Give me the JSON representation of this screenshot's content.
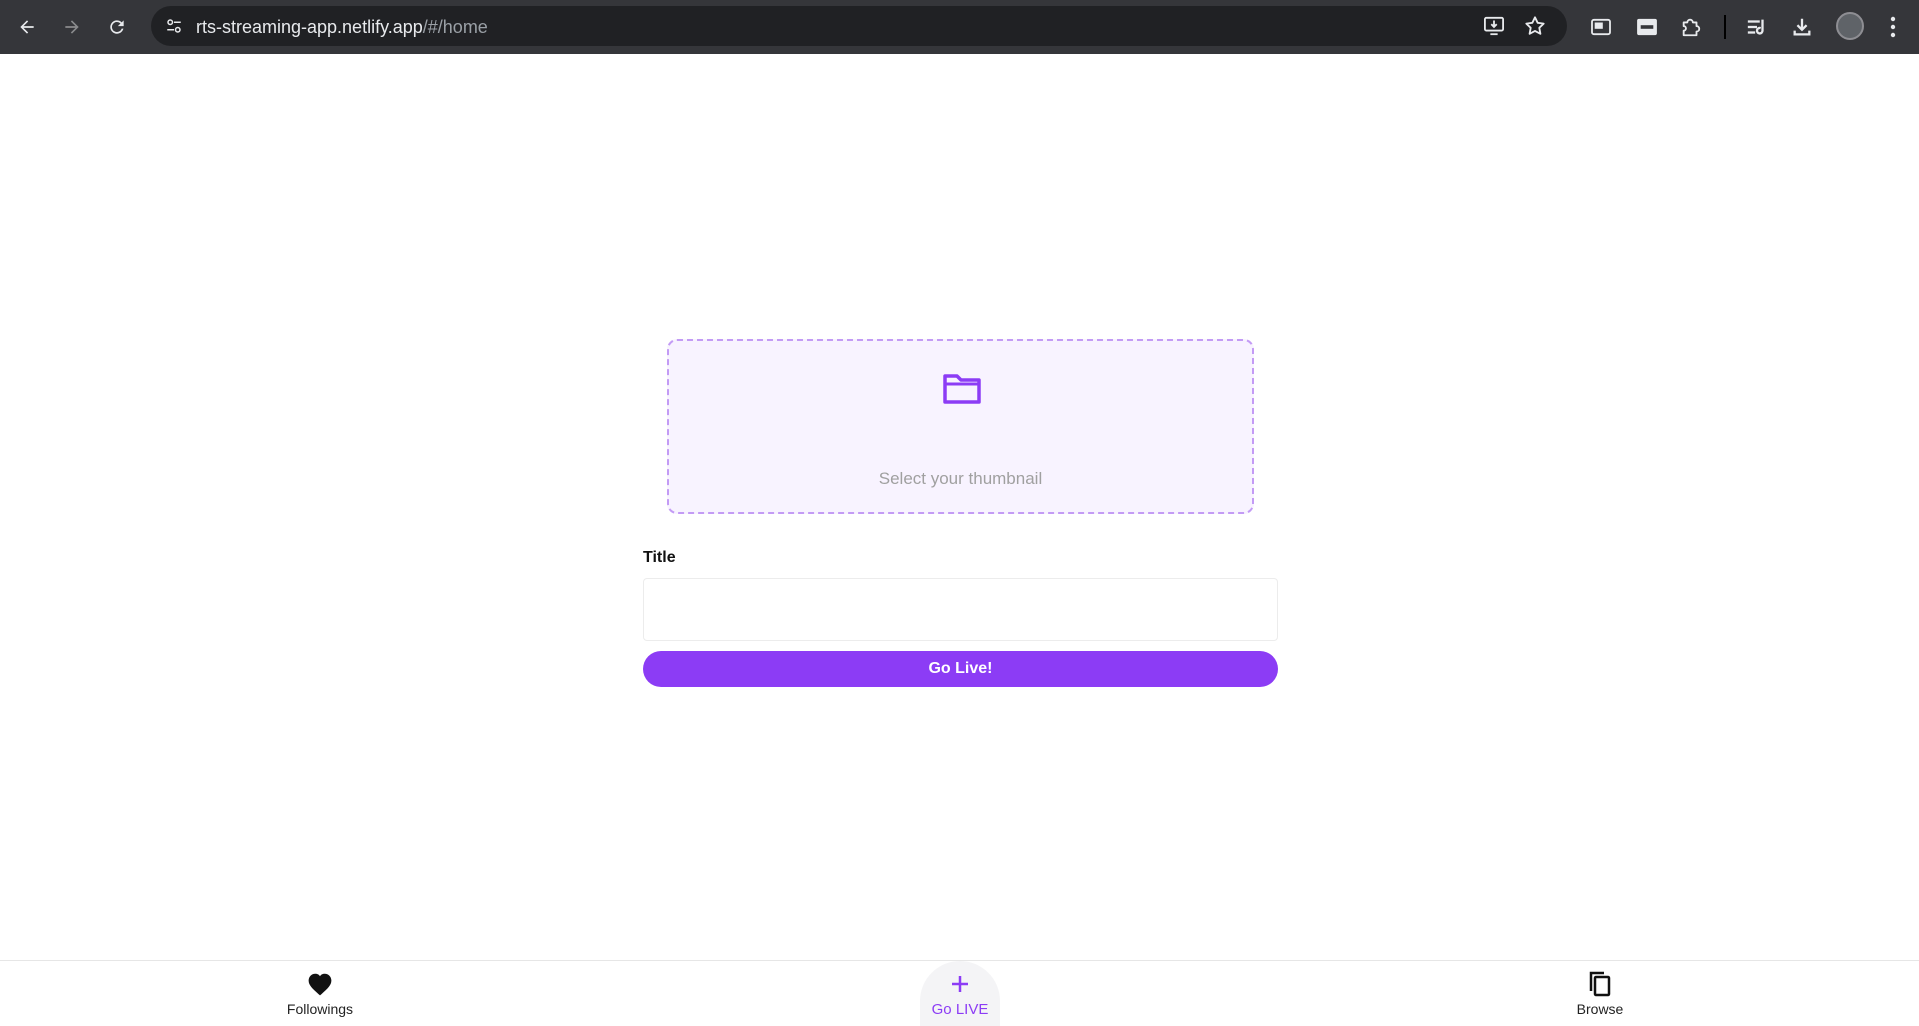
{
  "browser": {
    "url_domain": "rts-streaming-app.netlify.app",
    "url_path": "/#/home"
  },
  "upload": {
    "hint": "Select your thumbnail",
    "icon": "folder-icon"
  },
  "form": {
    "title_label": "Title",
    "title_value": "",
    "submit_label": "Go Live!"
  },
  "bottom_nav": {
    "items": [
      {
        "label": "Followings",
        "icon": "heart-icon"
      },
      {
        "label": "Go LIVE",
        "icon": "plus-icon"
      },
      {
        "label": "Browse",
        "icon": "copy-icon"
      }
    ]
  },
  "colors": {
    "accent": "#8c3cf5",
    "dropzone_bg": "#f8f3ff",
    "dropzone_border": "#c39bf5",
    "toolbar": "#35363a"
  }
}
